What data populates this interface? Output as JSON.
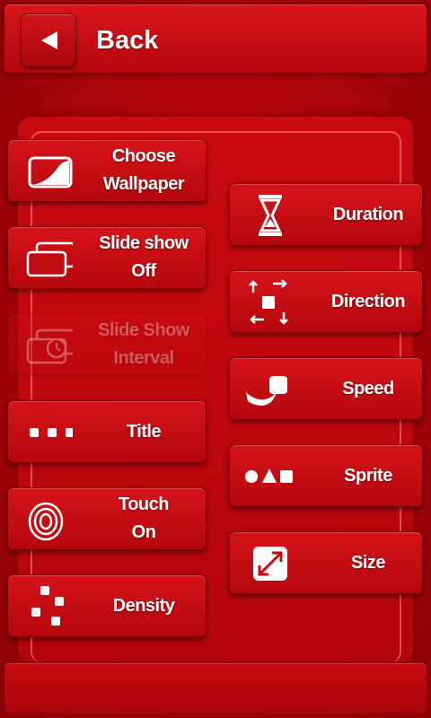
{
  "header": {
    "back_label": "Back"
  },
  "left_buttons": [
    {
      "id": "wallpaper",
      "line1": "Choose",
      "line2": "Wallpaper",
      "icon": "wallpaper-icon",
      "enabled": true
    },
    {
      "id": "slideshow",
      "line1": "Slide show",
      "line2": "Off",
      "icon": "slideshow-icon",
      "enabled": true
    },
    {
      "id": "interval",
      "line1": "Slide Show",
      "line2": "Interval",
      "icon": "timer-icon",
      "enabled": false
    },
    {
      "id": "title",
      "line1": "Title",
      "line2": "",
      "icon": "dots-icon",
      "enabled": true
    },
    {
      "id": "touch",
      "line1": "Touch",
      "line2": "On",
      "icon": "touch-ripple-icon",
      "enabled": true
    },
    {
      "id": "density",
      "line1": "Density",
      "line2": "",
      "icon": "density-icon",
      "enabled": true
    }
  ],
  "right_buttons": [
    {
      "id": "duration",
      "label": "Duration",
      "icon": "hourglass-icon"
    },
    {
      "id": "direction",
      "label": "Direction",
      "icon": "direction-arrows-icon"
    },
    {
      "id": "speed",
      "label": "Speed",
      "icon": "speed-icon"
    },
    {
      "id": "sprite",
      "label": "Sprite",
      "icon": "shapes-icon"
    },
    {
      "id": "size",
      "label": "Size",
      "icon": "resize-icon"
    }
  ],
  "colors": {
    "background": "#b5070d",
    "button": "#d6121a",
    "text": "#ffffff"
  }
}
